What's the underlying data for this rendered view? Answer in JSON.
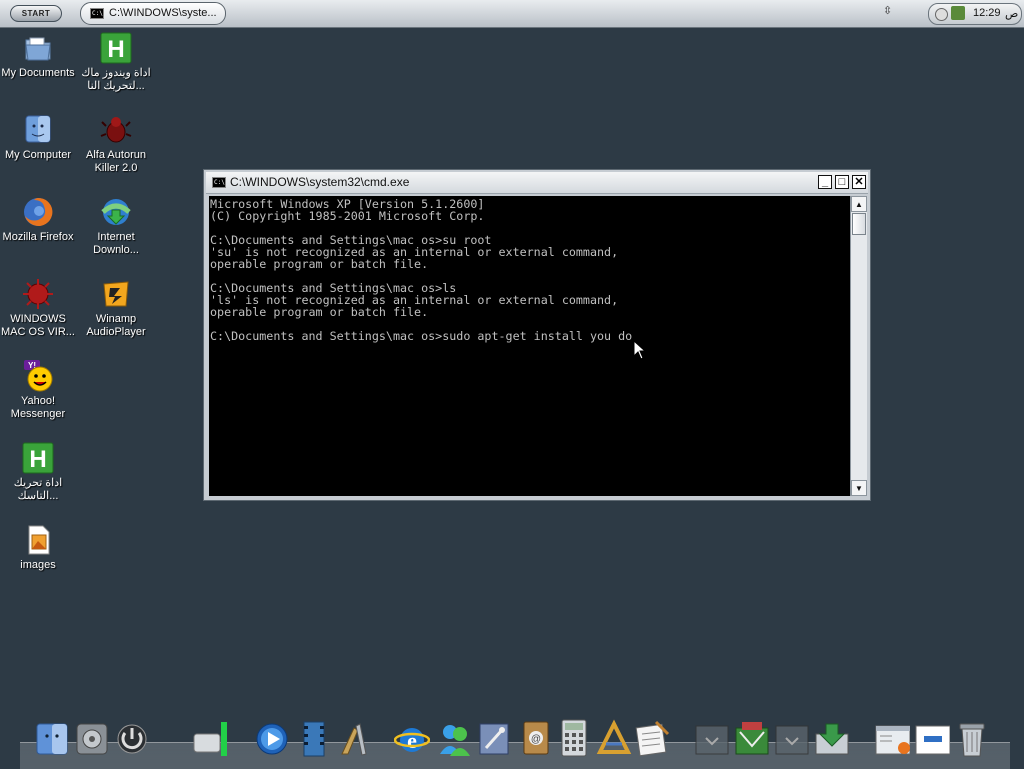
{
  "taskbar": {
    "start_label": "START",
    "task_label": "C:\\WINDOWS\\syste...",
    "clock": "12:29",
    "ampm": "ص"
  },
  "desktop_icons": [
    {
      "label": "My Documents"
    },
    {
      "label": "اداة ويندوز ماك لتحريك النا..."
    },
    {
      "label": "My Computer"
    },
    {
      "label": "Alfa Autorun Killer 2.0"
    },
    {
      "label": "Mozilla Firefox"
    },
    {
      "label": "Internet Downlo..."
    },
    {
      "label": "WINDOWS MAC OS VIR..."
    },
    {
      "label": "Winamp AudioPlayer"
    },
    {
      "label": "Yahoo! Messenger"
    },
    {
      "label": "اداة تحريك التاسك..."
    },
    {
      "label": "images"
    }
  ],
  "cmd_window": {
    "title": "C:\\WINDOWS\\system32\\cmd.exe",
    "minimize_glyph": "_",
    "maximize_glyph": "□",
    "close_glyph": "✕",
    "lines": [
      "Microsoft Windows XP [Version 5.1.2600]",
      "(C) Copyright 1985-2001 Microsoft Corp.",
      "",
      "C:\\Documents and Settings\\mac os>su root",
      "'su' is not recognized as an internal or external command,",
      "operable program or batch file.",
      "",
      "C:\\Documents and Settings\\mac os>ls",
      "'ls' is not recognized as an internal or external command,",
      "operable program or batch file.",
      "",
      "C:\\Documents and Settings\\mac os>sudo apt-get install you do"
    ]
  },
  "dock": {
    "icons": [
      "finder-icon",
      "system-preferences-icon",
      "power-icon",
      "drive-icon",
      "quicktime-icon",
      "film-icon",
      "tools-icon",
      "ie-icon",
      "msn-messenger-icon",
      "mail-icon",
      "address-book-icon",
      "calculator-icon",
      "text-edit-icon",
      "script-icon",
      "stack-icon",
      "downloads-icon",
      "window-preview-icon",
      "window-preview-icon-2",
      "trash-icon"
    ]
  },
  "colors": {
    "desktop": "#2d3a45",
    "console_bg": "#000000",
    "console_text": "#c0c0c0"
  }
}
